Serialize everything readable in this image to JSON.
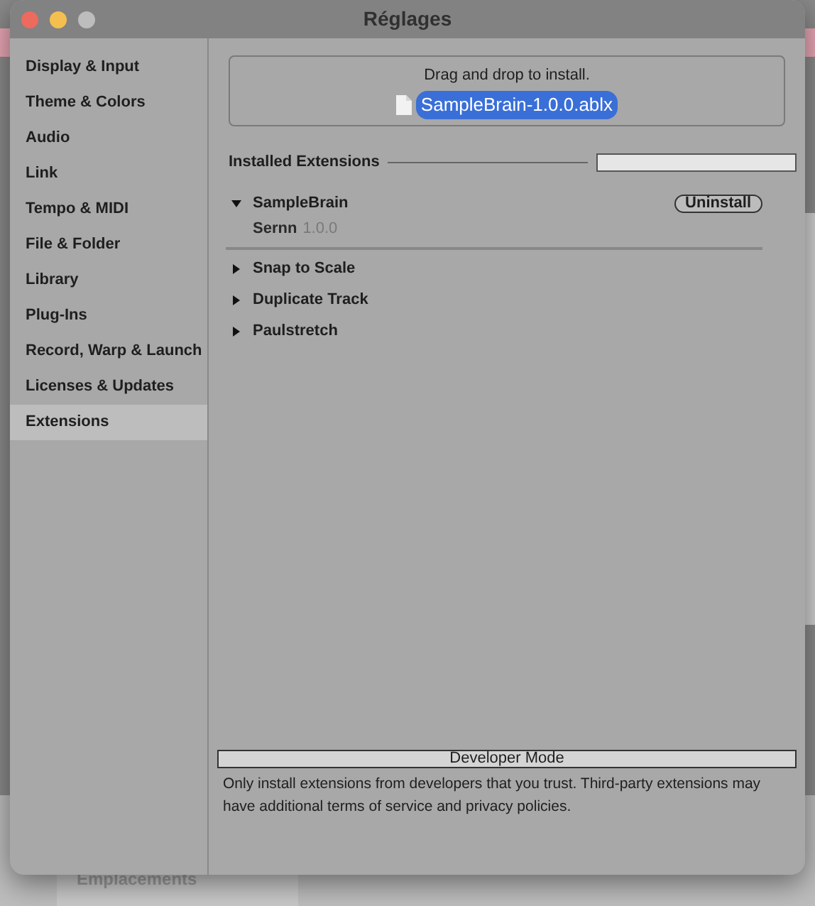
{
  "background": {
    "section_label": "Emplacements"
  },
  "window": {
    "title": "Réglages"
  },
  "sidebar": {
    "items": [
      {
        "label": "Display & Input",
        "selected": false
      },
      {
        "label": "Theme & Colors",
        "selected": false
      },
      {
        "label": "Audio",
        "selected": false
      },
      {
        "label": "Link",
        "selected": false
      },
      {
        "label": "Tempo & MIDI",
        "selected": false
      },
      {
        "label": "File & Folder",
        "selected": false
      },
      {
        "label": "Library",
        "selected": false
      },
      {
        "label": "Plug-Ins",
        "selected": false
      },
      {
        "label": "Record, Warp & Launch",
        "selected": false
      },
      {
        "label": "Licenses & Updates",
        "selected": false
      },
      {
        "label": "Extensions",
        "selected": true
      }
    ]
  },
  "drop_zone": {
    "hint": "Drag and drop to install.",
    "file": "SampleBrain-1.0.0.ablx"
  },
  "installed": {
    "heading": "Installed Extensions",
    "extensions": [
      {
        "name": "SampleBrain",
        "expanded": true,
        "author": "Sernn",
        "version": "1.0.0",
        "action": "Uninstall"
      },
      {
        "name": "Snap to Scale",
        "expanded": false
      },
      {
        "name": "Duplicate Track",
        "expanded": false
      },
      {
        "name": "Paulstretch",
        "expanded": false
      }
    ]
  },
  "developer_mode": {
    "label": "Developer Mode",
    "note": "Only install extensions from developers that you trust. Third-party extensions may have additional terms of service and privacy policies."
  }
}
